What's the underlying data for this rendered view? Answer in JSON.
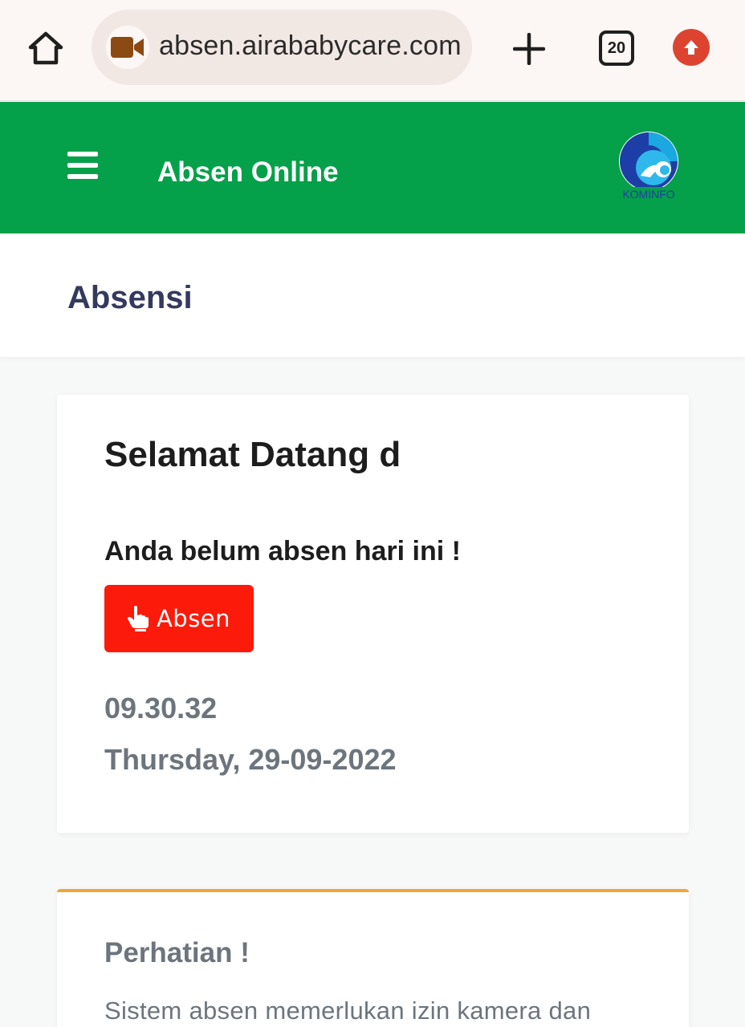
{
  "browser": {
    "url": "absen.airababycare.com",
    "tab_count": "20",
    "icons": {
      "home": "home-icon",
      "site": "video-camera-icon",
      "new_tab": "plus-icon",
      "tabs": "tab-switcher-icon",
      "update": "upload-arrow-icon"
    }
  },
  "header": {
    "title": "Absen Online",
    "logo_text": "KOMINFO",
    "menu_icon": "hamburger-menu-icon",
    "bg_color": "#05a04a"
  },
  "page": {
    "title": "Absensi"
  },
  "welcome": {
    "heading": "Selamat Datang d",
    "status": "Anda belum absen hari ini !",
    "button_label": "Absen",
    "button_icon": "hand-pointer-icon",
    "button_color": "#fc1a0a",
    "time": "09.30.32",
    "date": "Thursday, 29-09-2022"
  },
  "notice": {
    "title": "Perhatian !",
    "body": "Sistem absen memerlukan izin kamera dan",
    "accent_color": "#f3a53a"
  }
}
